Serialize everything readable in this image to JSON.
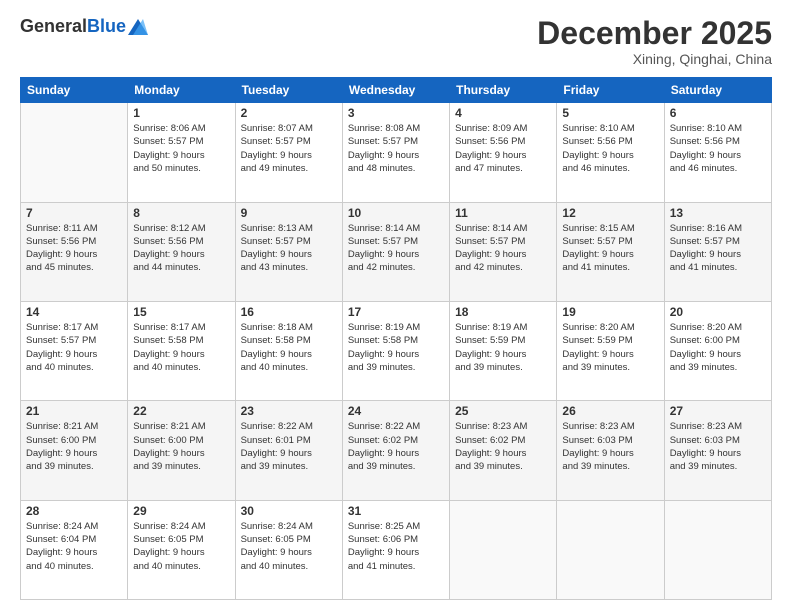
{
  "header": {
    "logo_general": "General",
    "logo_blue": "Blue",
    "month_title": "December 2025",
    "location": "Xining, Qinghai, China"
  },
  "weekdays": [
    "Sunday",
    "Monday",
    "Tuesday",
    "Wednesday",
    "Thursday",
    "Friday",
    "Saturday"
  ],
  "weeks": [
    [
      {
        "day": "",
        "info": ""
      },
      {
        "day": "1",
        "info": "Sunrise: 8:06 AM\nSunset: 5:57 PM\nDaylight: 9 hours\nand 50 minutes."
      },
      {
        "day": "2",
        "info": "Sunrise: 8:07 AM\nSunset: 5:57 PM\nDaylight: 9 hours\nand 49 minutes."
      },
      {
        "day": "3",
        "info": "Sunrise: 8:08 AM\nSunset: 5:57 PM\nDaylight: 9 hours\nand 48 minutes."
      },
      {
        "day": "4",
        "info": "Sunrise: 8:09 AM\nSunset: 5:56 PM\nDaylight: 9 hours\nand 47 minutes."
      },
      {
        "day": "5",
        "info": "Sunrise: 8:10 AM\nSunset: 5:56 PM\nDaylight: 9 hours\nand 46 minutes."
      },
      {
        "day": "6",
        "info": "Sunrise: 8:10 AM\nSunset: 5:56 PM\nDaylight: 9 hours\nand 46 minutes."
      }
    ],
    [
      {
        "day": "7",
        "info": "Sunrise: 8:11 AM\nSunset: 5:56 PM\nDaylight: 9 hours\nand 45 minutes."
      },
      {
        "day": "8",
        "info": "Sunrise: 8:12 AM\nSunset: 5:56 PM\nDaylight: 9 hours\nand 44 minutes."
      },
      {
        "day": "9",
        "info": "Sunrise: 8:13 AM\nSunset: 5:57 PM\nDaylight: 9 hours\nand 43 minutes."
      },
      {
        "day": "10",
        "info": "Sunrise: 8:14 AM\nSunset: 5:57 PM\nDaylight: 9 hours\nand 42 minutes."
      },
      {
        "day": "11",
        "info": "Sunrise: 8:14 AM\nSunset: 5:57 PM\nDaylight: 9 hours\nand 42 minutes."
      },
      {
        "day": "12",
        "info": "Sunrise: 8:15 AM\nSunset: 5:57 PM\nDaylight: 9 hours\nand 41 minutes."
      },
      {
        "day": "13",
        "info": "Sunrise: 8:16 AM\nSunset: 5:57 PM\nDaylight: 9 hours\nand 41 minutes."
      }
    ],
    [
      {
        "day": "14",
        "info": "Sunrise: 8:17 AM\nSunset: 5:57 PM\nDaylight: 9 hours\nand 40 minutes."
      },
      {
        "day": "15",
        "info": "Sunrise: 8:17 AM\nSunset: 5:58 PM\nDaylight: 9 hours\nand 40 minutes."
      },
      {
        "day": "16",
        "info": "Sunrise: 8:18 AM\nSunset: 5:58 PM\nDaylight: 9 hours\nand 40 minutes."
      },
      {
        "day": "17",
        "info": "Sunrise: 8:19 AM\nSunset: 5:58 PM\nDaylight: 9 hours\nand 39 minutes."
      },
      {
        "day": "18",
        "info": "Sunrise: 8:19 AM\nSunset: 5:59 PM\nDaylight: 9 hours\nand 39 minutes."
      },
      {
        "day": "19",
        "info": "Sunrise: 8:20 AM\nSunset: 5:59 PM\nDaylight: 9 hours\nand 39 minutes."
      },
      {
        "day": "20",
        "info": "Sunrise: 8:20 AM\nSunset: 6:00 PM\nDaylight: 9 hours\nand 39 minutes."
      }
    ],
    [
      {
        "day": "21",
        "info": "Sunrise: 8:21 AM\nSunset: 6:00 PM\nDaylight: 9 hours\nand 39 minutes."
      },
      {
        "day": "22",
        "info": "Sunrise: 8:21 AM\nSunset: 6:00 PM\nDaylight: 9 hours\nand 39 minutes."
      },
      {
        "day": "23",
        "info": "Sunrise: 8:22 AM\nSunset: 6:01 PM\nDaylight: 9 hours\nand 39 minutes."
      },
      {
        "day": "24",
        "info": "Sunrise: 8:22 AM\nSunset: 6:02 PM\nDaylight: 9 hours\nand 39 minutes."
      },
      {
        "day": "25",
        "info": "Sunrise: 8:23 AM\nSunset: 6:02 PM\nDaylight: 9 hours\nand 39 minutes."
      },
      {
        "day": "26",
        "info": "Sunrise: 8:23 AM\nSunset: 6:03 PM\nDaylight: 9 hours\nand 39 minutes."
      },
      {
        "day": "27",
        "info": "Sunrise: 8:23 AM\nSunset: 6:03 PM\nDaylight: 9 hours\nand 39 minutes."
      }
    ],
    [
      {
        "day": "28",
        "info": "Sunrise: 8:24 AM\nSunset: 6:04 PM\nDaylight: 9 hours\nand 40 minutes."
      },
      {
        "day": "29",
        "info": "Sunrise: 8:24 AM\nSunset: 6:05 PM\nDaylight: 9 hours\nand 40 minutes."
      },
      {
        "day": "30",
        "info": "Sunrise: 8:24 AM\nSunset: 6:05 PM\nDaylight: 9 hours\nand 40 minutes."
      },
      {
        "day": "31",
        "info": "Sunrise: 8:25 AM\nSunset: 6:06 PM\nDaylight: 9 hours\nand 41 minutes."
      },
      {
        "day": "",
        "info": ""
      },
      {
        "day": "",
        "info": ""
      },
      {
        "day": "",
        "info": ""
      }
    ]
  ],
  "row_shading": [
    "white",
    "shade",
    "white",
    "shade",
    "white"
  ]
}
